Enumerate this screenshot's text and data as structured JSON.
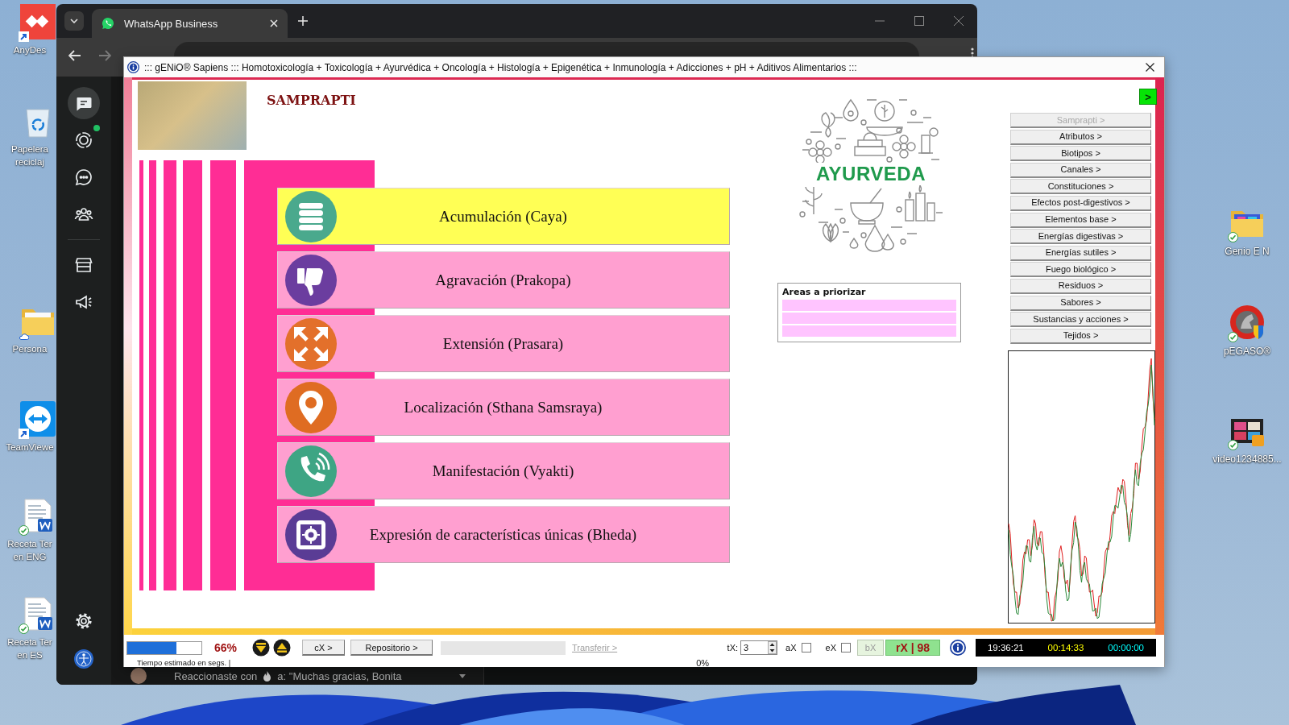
{
  "desktop": {
    "left_icons": [
      {
        "kind": "remote-desk",
        "shortcut": true,
        "synced": false,
        "cloud": false,
        "label_lines": [
          "AnyDes"
        ]
      },
      {
        "kind": "recycle-bin",
        "shortcut": false,
        "synced": false,
        "cloud": false,
        "label_lines": [
          "Papelera",
          "reciclaj"
        ]
      },
      {
        "kind": "folder",
        "shortcut": false,
        "synced": false,
        "cloud": true,
        "label_lines": [
          "Persona"
        ]
      },
      {
        "kind": "remote-viewer",
        "shortcut": true,
        "synced": false,
        "cloud": false,
        "label_lines": [
          "TeamViewe"
        ]
      },
      {
        "kind": "word-doc",
        "shortcut": false,
        "synced": true,
        "cloud": false,
        "label_lines": [
          "Receta Ter",
          "en ENG"
        ]
      },
      {
        "kind": "word-doc",
        "shortcut": false,
        "synced": true,
        "cloud": false,
        "label_lines": [
          "Receta Ter",
          "en ES"
        ]
      }
    ],
    "right_icons": [
      {
        "kind": "media-folder",
        "shortcut": false,
        "synced": true,
        "cloud": false,
        "label_lines": [
          "Genio E N"
        ]
      },
      {
        "kind": "horse-app",
        "shortcut": false,
        "synced": true,
        "cloud": false,
        "label_lines": [
          "pEGASO®"
        ]
      },
      {
        "kind": "video-file",
        "shortcut": false,
        "synced": true,
        "cloud": false,
        "label_lines": [
          "video1234885..."
        ]
      }
    ]
  },
  "browser": {
    "tab": {
      "title": "WhatsApp Business"
    },
    "nav_top": [
      {
        "kind": "chats",
        "selected": true,
        "unread": false
      },
      {
        "kind": "status",
        "selected": false,
        "unread": true
      },
      {
        "kind": "channels",
        "selected": false,
        "unread": false
      },
      {
        "kind": "communities",
        "selected": false,
        "unread": false
      }
    ],
    "nav_tools": [
      {
        "kind": "tools",
        "selected": false,
        "unread": false
      },
      {
        "kind": "advertise",
        "selected": false,
        "unread": false
      }
    ],
    "nav_bottom": [
      {
        "kind": "settings",
        "selected": false,
        "unread": false
      },
      {
        "kind": "profile",
        "selected": false,
        "unread": false
      }
    ],
    "chat_preview": {
      "text": "Reaccionaste con",
      "quote": "a: \"Muchas gracias, Bonita"
    }
  },
  "app": {
    "title": "::: gENiO® Sapiens ::: Homotoxicología + Toxicología + Ayurvédica + Oncología + Histología + Epigenética + Inmunología + Adicciones + pH + Aditivos Alimentarios :::",
    "heading": "SAMPRAPTI",
    "stages": [
      {
        "label": "Acumulación (Caya)",
        "kind": "stack",
        "selected": true
      },
      {
        "label": "Agravación (Prakopa)",
        "kind": "thumb-down",
        "selected": false
      },
      {
        "label": "Extensión (Prasara)",
        "kind": "expand",
        "selected": false
      },
      {
        "label": "Localización (Sthana Samsraya)",
        "kind": "pin",
        "selected": false
      },
      {
        "label": "Manifestación (Vyakti)",
        "kind": "phone",
        "selected": false
      },
      {
        "label": "Expresión de características únicas (Bheda)",
        "kind": "safe",
        "selected": false
      }
    ],
    "logo": {
      "wordmark": "AYURVEDA"
    },
    "priority_box": {
      "title": "Areas a priorizar"
    },
    "next_button": {
      "label": ">"
    },
    "sections": [
      {
        "label": "Samprapti >",
        "disabled": true
      },
      {
        "label": "Atributos >",
        "disabled": false
      },
      {
        "label": "Biotipos >",
        "disabled": false
      },
      {
        "label": "Canales >",
        "disabled": false
      },
      {
        "label": "Constituciones >",
        "disabled": false
      },
      {
        "label": "Efectos post-digestivos >",
        "disabled": false
      },
      {
        "label": "Elementos base >",
        "disabled": false
      },
      {
        "label": "Energías digestivas >",
        "disabled": false
      },
      {
        "label": "Energías sutiles >",
        "disabled": false
      },
      {
        "label": "Fuego biológico >",
        "disabled": false
      },
      {
        "label": "Residuos >",
        "disabled": false
      },
      {
        "label": "Sabores >",
        "disabled": false
      },
      {
        "label": "Sustancias y acciones >",
        "disabled": false
      },
      {
        "label": "Tejidos >",
        "disabled": false
      }
    ],
    "status_bar": {
      "progress": {
        "level": 0.66,
        "reading": "66%",
        "caption": "Tiempo estimado en segs. |"
      },
      "arrow_buttons": [
        {
          "kind": "down"
        },
        {
          "kind": "up"
        }
      ],
      "buttons": [
        {
          "label": "cX >"
        },
        {
          "label": "Repositorio >"
        }
      ],
      "transfer": {
        "link": "Transferir >",
        "disabled": true,
        "reading": "0%"
      },
      "tx": {
        "label": "tX:",
        "value": "3"
      },
      "options": [
        {
          "label": "aX",
          "checked": false
        },
        {
          "label": "eX",
          "checked": false
        }
      ],
      "bx_button": {
        "label": "bX",
        "disabled": true
      },
      "rx_button": {
        "label": "rX | 98"
      },
      "clocks": [
        {
          "text": "19:36:21",
          "color": "#ffffff"
        },
        {
          "text": "00:14:33",
          "color": "#ffff00"
        },
        {
          "text": "00:00:00",
          "color": "#00ffff"
        }
      ]
    }
  }
}
